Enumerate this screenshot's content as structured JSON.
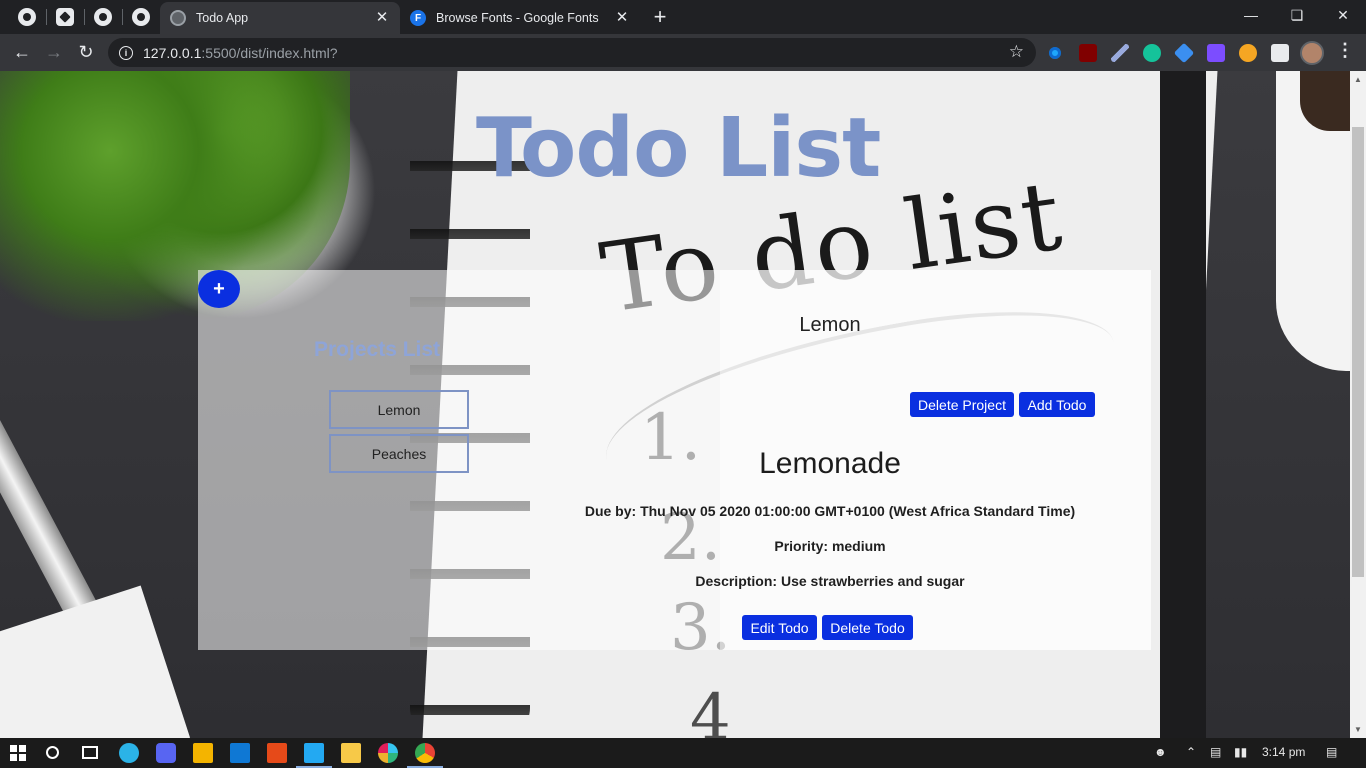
{
  "browser": {
    "tabs": [
      {
        "title": "Todo App",
        "active": true
      },
      {
        "title": "Browse Fonts - Google Fonts",
        "active": false
      }
    ],
    "url_host": "127.0.0.1",
    "url_rest": ":5500/dist/index.html?",
    "pinned_icons": [
      "github-icon",
      "codepen-icon",
      "github-icon",
      "github-icon"
    ],
    "extensions": [
      "extension-c-icon",
      "ublock-icon",
      "pen-icon",
      "grammarly-icon",
      "extension-diamond-icon",
      "vimium-icon",
      "eyes-icon",
      "puzzle-icon"
    ]
  },
  "app": {
    "title": "Todo List",
    "add_project_label": "+",
    "projects_heading": "Projects List",
    "projects": [
      "Lemon",
      "Peaches"
    ],
    "current_project": "Lemon",
    "delete_project_label": "Delete Project",
    "add_todo_label": "Add Todo",
    "todo": {
      "title": "Lemonade",
      "due": "Due by: Thu Nov 05 2020 01:00:00 GMT+0100 (West Africa Standard Time)",
      "priority": "Priority: medium",
      "description": "Description: Use strawberries and sugar"
    },
    "edit_todo_label": "Edit Todo",
    "delete_todo_label": "Delete Todo"
  },
  "background_art": {
    "handwritten_title": "To do list",
    "numbers": [
      "1.",
      "2.",
      "3.",
      "4"
    ]
  },
  "taskbar": {
    "time": "3:14 pm",
    "apps": [
      "windows-start-icon",
      "search-icon",
      "task-view-icon",
      "edge-icon",
      "discord-icon",
      "store-icon",
      "mail-icon",
      "office-icon",
      "vscode-icon",
      "file-explorer-icon",
      "slack-icon",
      "chrome-icon"
    ]
  },
  "colors": {
    "accent_blue": "#0a2fe0",
    "title_blue": "#7b93c8",
    "heading_blue": "#8ea4d8",
    "chrome_dark": "#202124"
  }
}
